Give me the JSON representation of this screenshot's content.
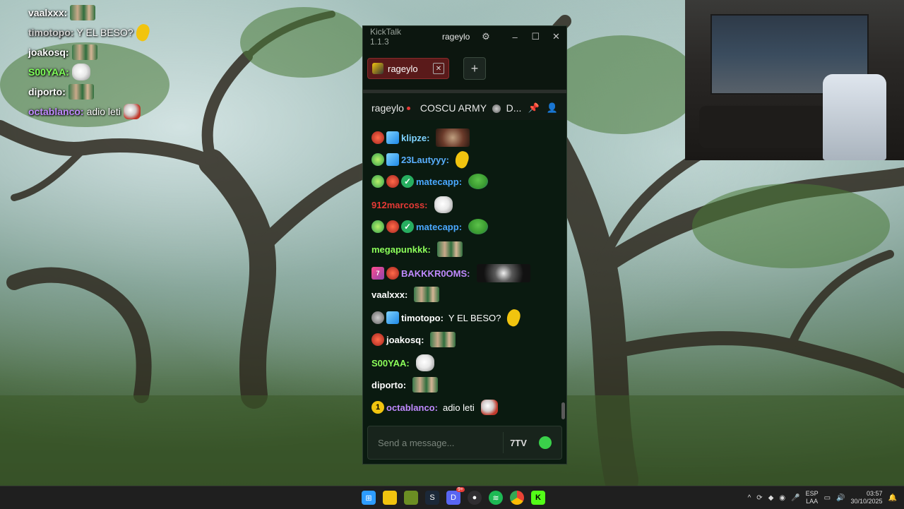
{
  "overlay_chat": [
    {
      "user": "vaalxxx:",
      "color": "#ffffff",
      "msg": "",
      "emote": "group"
    },
    {
      "user": "timotopo:",
      "color": "#cfcfcf",
      "msg": "Y EL BESO?",
      "emote": "banana"
    },
    {
      "user": "joakosq:",
      "color": "#ffffff",
      "msg": "",
      "emote": "group"
    },
    {
      "user": "S00YAA:",
      "color": "#7fff5a",
      "msg": "",
      "emote": "dog"
    },
    {
      "user": "diporto:",
      "color": "#ffffff",
      "msg": "",
      "emote": "group"
    },
    {
      "user": "octablanco:",
      "color": "#c08aff",
      "msg": "adio leti",
      "emote": "fist"
    }
  ],
  "window": {
    "app_title": "KickTalk 1.1.3",
    "user_title": "rageylo"
  },
  "tabs": [
    {
      "label": "rageylo"
    }
  ],
  "channel": {
    "name": "rageylo",
    "pinned": "COSCU ARMY",
    "pinned_suffix": "D..."
  },
  "messages": [
    {
      "user": "klipze:",
      "color": "#7fd3ff",
      "badges": [
        "red",
        "cube"
      ],
      "emote": "skull",
      "text": ""
    },
    {
      "user": "23Lautyyy:",
      "color": "#5ab0ff",
      "badges": [
        "alien",
        "cube"
      ],
      "emote": "banana",
      "text": ""
    },
    {
      "user": "matecapp:",
      "color": "#4aa8ff",
      "badges": [
        "alien",
        "red",
        "verified"
      ],
      "emote": "frog",
      "text": ""
    },
    {
      "user": "912marcoss:",
      "color": "#e53935",
      "badges": [],
      "emote": "dog",
      "text": ""
    },
    {
      "user": "matecapp:",
      "color": "#4aa8ff",
      "badges": [
        "alien",
        "red",
        "verified"
      ],
      "emote": "frog",
      "text": ""
    },
    {
      "user": "megapunkkk:",
      "color": "#8cff5a",
      "badges": [],
      "emote": "group",
      "text": ""
    },
    {
      "user": "BAKKKR0OMS:",
      "color": "#c08aff",
      "badges": [
        "sub",
        "red"
      ],
      "emote": "dark",
      "text": ""
    },
    {
      "user": "vaalxxx:",
      "color": "#ffffff",
      "badges": [],
      "emote": "group",
      "text": ""
    },
    {
      "user": "timotopo:",
      "color": "#ffffff",
      "badges": [
        "gray",
        "cube"
      ],
      "emote": "banana",
      "text": "Y EL BESO?"
    },
    {
      "user": "joakosq:",
      "color": "#ffffff",
      "badges": [
        "red"
      ],
      "emote": "group",
      "text": ""
    },
    {
      "user": "S00YAA:",
      "color": "#8cff5a",
      "badges": [],
      "emote": "dog",
      "text": ""
    },
    {
      "user": "diporto:",
      "color": "#ffffff",
      "badges": [],
      "emote": "group",
      "text": ""
    },
    {
      "user": "octablanco:",
      "color": "#c08aff",
      "badges": [
        "one"
      ],
      "emote": "fist",
      "text": "adio leti"
    }
  ],
  "input": {
    "placeholder": "Send a message..."
  },
  "taskbar": {
    "lang_top": "ESP",
    "lang_bottom": "LAA",
    "time": "03:57",
    "date": "30/10/2025",
    "discord_badge": "9+"
  }
}
